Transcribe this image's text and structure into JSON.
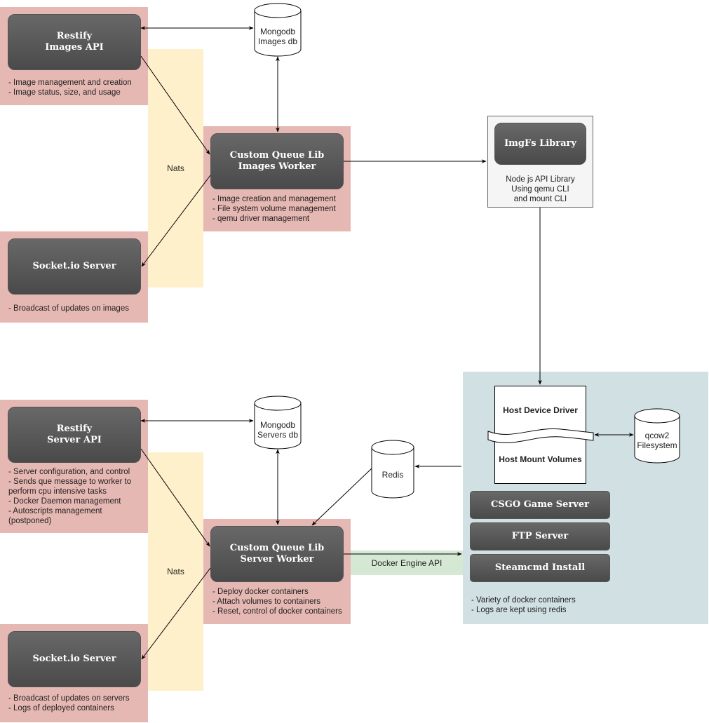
{
  "images_section": {
    "nats_label": "Nats",
    "restify_api": {
      "title_line1": "Restify",
      "title_line2": "Images API",
      "notes": "- Image management and creation\n- Image status, size, and usage"
    },
    "mongodb": {
      "text": "Mongodb\nImages db"
    },
    "worker": {
      "title_line1": "Custom Queue Lib",
      "title_line2": "Images Worker",
      "notes": "- Image creation and management\n- File system volume management\n- qemu driver management"
    },
    "socket_server": {
      "title": "Socket.io Server",
      "notes": "- Broadcast of updates on images"
    },
    "imgfs": {
      "title": "ImgFs Library",
      "notes": "Node js API Library\nUsing qemu CLI\nand mount CLI"
    }
  },
  "servers_section": {
    "nats_label": "Nats",
    "restify_api": {
      "title_line1": "Restify",
      "title_line2": "Server API",
      "notes": "- Server configuration, and control\n- Sends que message to worker to\nperform cpu intensive tasks\n- Docker Daemon management\n- Autoscripts management\n(postponed)"
    },
    "mongodb": {
      "text": "Mongodb\nServers db"
    },
    "redis": {
      "text": "Redis"
    },
    "worker": {
      "title_line1": "Custom Queue Lib",
      "title_line2": "Server Worker",
      "notes": "- Deploy docker containers\n- Attach volumes to containers\n- Reset, control of docker containers"
    },
    "docker_engine_label": "Docker Engine API",
    "socket_server": {
      "title": "Socket.io Server",
      "notes": "- Broadcast of updates on servers\n- Logs of deployed containers"
    }
  },
  "host": {
    "device_driver": "Host Device Driver",
    "mount_volumes": "Host Mount Volumes",
    "qcow2": {
      "text": "qcow2\nFilesystem"
    },
    "containers": [
      "CSGO Game Server",
      "FTP Server",
      "Steamcmd Install"
    ],
    "notes": "- Variety of docker containers\n- Logs are kept using redis"
  },
  "colors": {
    "component_bg": "#e6b8b3",
    "nats_bg": "#fff0cc",
    "host_bg": "#d0e0e3",
    "docker_api_bg": "#d5e8d4",
    "library_bg": "#f5f5f5",
    "node_dark": "#555555"
  }
}
